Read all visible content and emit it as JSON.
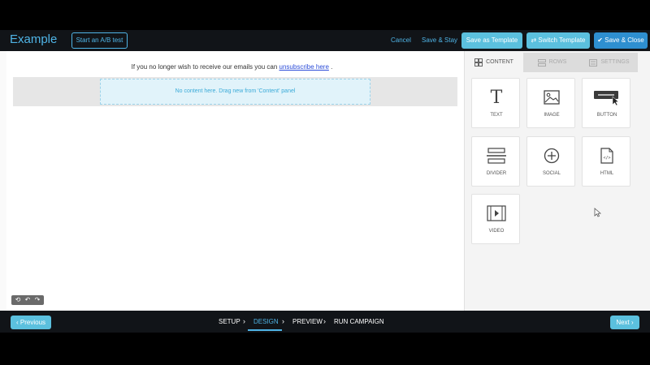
{
  "header": {
    "title": "Example",
    "ab_test_label": "Start an A/B test",
    "cancel_label": "Cancel",
    "save_stay_label": "Save & Stay",
    "save_template_label": "Save as Template",
    "switch_template_label": "Switch Template",
    "save_close_label": "Save & Close"
  },
  "canvas": {
    "unsubscribe_prefix": "If you no longer wish to receive our emails you can",
    "unsubscribe_link": "unsubscribe here",
    "unsubscribe_suffix": ".",
    "drop_zone_text": "No content here. Drag new from 'Content' panel"
  },
  "panel": {
    "tabs": [
      {
        "label": "CONTENT",
        "icon": "grid-icon",
        "active": true
      },
      {
        "label": "ROWS",
        "icon": "rows-icon",
        "active": false
      },
      {
        "label": "SETTINGS",
        "icon": "settings-icon",
        "active": false
      }
    ],
    "blocks": [
      {
        "label": "TEXT",
        "icon": "text-icon"
      },
      {
        "label": "IMAGE",
        "icon": "image-icon"
      },
      {
        "label": "BUTTON",
        "icon": "button-icon"
      },
      {
        "label": "DIVIDER",
        "icon": "divider-icon"
      },
      {
        "label": "SOCIAL",
        "icon": "social-icon"
      },
      {
        "label": "HTML",
        "icon": "html-icon"
      },
      {
        "label": "VIDEO",
        "icon": "video-icon"
      }
    ]
  },
  "footer": {
    "previous_label": "Previous",
    "next_label": "Next",
    "steps": [
      "SETUP",
      "DESIGN",
      "PREVIEW",
      "RUN CAMPAIGN"
    ],
    "active_step": "DESIGN"
  },
  "colors": {
    "accent": "#4fb4e6",
    "button_cyan": "#5bc0de",
    "button_blue": "#2e8fd0",
    "bar_background": "#111418"
  }
}
